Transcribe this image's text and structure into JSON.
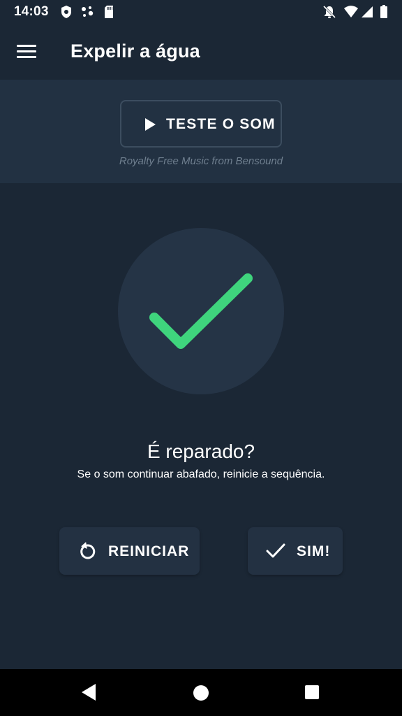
{
  "status_bar": {
    "time": "14:03",
    "left_icons": [
      "shield-icon",
      "assistant-dots-icon",
      "sd-card-icon"
    ],
    "right_icons": [
      "notifications-off-icon",
      "wifi-icon",
      "signal-icon",
      "battery-icon"
    ]
  },
  "app_bar": {
    "menu_icon": "hamburger-menu-icon",
    "title": "Expelir a água"
  },
  "sound_panel": {
    "test_button_label": "TESTE O SOM",
    "test_button_icon": "play-icon",
    "credit": "Royalty Free Music from Bensound"
  },
  "result": {
    "icon": "checkmark-icon",
    "question": "É reparado?",
    "hint": "Se o som continuar abafado, reinicie a sequência."
  },
  "actions": {
    "restart_label": "REINICIAR",
    "restart_icon": "restart-icon",
    "yes_label": "SIM!",
    "yes_icon": "check-icon"
  },
  "nav_bar": {
    "icons": [
      "back-icon",
      "home-icon",
      "recents-icon"
    ]
  },
  "colors": {
    "background": "#1b2735",
    "panel": "#223142",
    "circle": "#253446",
    "check_green": "#3fd47d",
    "button": "#233142",
    "nav_bar": "#000000"
  }
}
